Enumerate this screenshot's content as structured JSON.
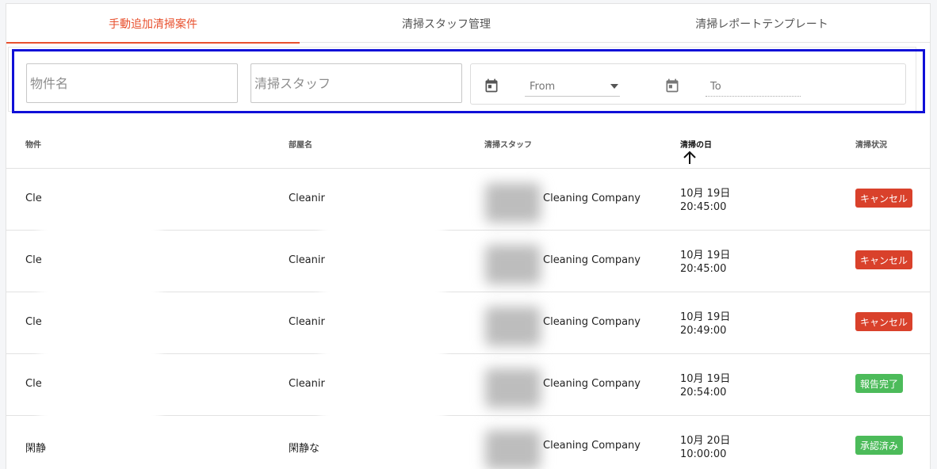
{
  "tabs": [
    {
      "label": "手動追加清掃案件",
      "active": true
    },
    {
      "label": "清掃スタッフ管理",
      "active": false
    },
    {
      "label": "清掃レポートテンプレート",
      "active": false
    }
  ],
  "filters": {
    "property_placeholder": "物件名",
    "staff_placeholder": "清掃スタッフ",
    "from_placeholder": "From",
    "to_placeholder": "To"
  },
  "table": {
    "headers": [
      "物件",
      "部屋名",
      "清掃スタッフ",
      "清掃の日",
      "清掃状況"
    ],
    "sorted_column": "清掃の日",
    "rows": [
      {
        "property": "Cle",
        "room": "Cleanir",
        "staff": "Cleaning Company",
        "date": "10月 19日",
        "time": "20:45:00",
        "status": "キャンセル",
        "status_color": "#d9412b"
      },
      {
        "property": "Cle",
        "room": "Cleanir",
        "staff": "Cleaning Company",
        "date": "10月 19日",
        "time": "20:45:00",
        "status": "キャンセル",
        "status_color": "#d9412b"
      },
      {
        "property": "Cle",
        "room": "Cleanir",
        "staff": "Cleaning Company",
        "date": "10月 19日",
        "time": "20:49:00",
        "status": "キャンセル",
        "status_color": "#d9412b"
      },
      {
        "property": "Cle",
        "room": "Cleanir",
        "staff": "Cleaning Company",
        "date": "10月 19日",
        "time": "20:54:00",
        "status": "報告完了",
        "status_color": "#4cbb5a"
      },
      {
        "property": "閑静",
        "room": "閑静な",
        "staff": "Cleaning Company",
        "date": "10月 20日",
        "time": "10:00:00",
        "status": "承認済み",
        "status_color": "#4cbb5a"
      }
    ]
  },
  "colors": {
    "accent": "#e8502e",
    "highlight_border": "#1010d8"
  }
}
